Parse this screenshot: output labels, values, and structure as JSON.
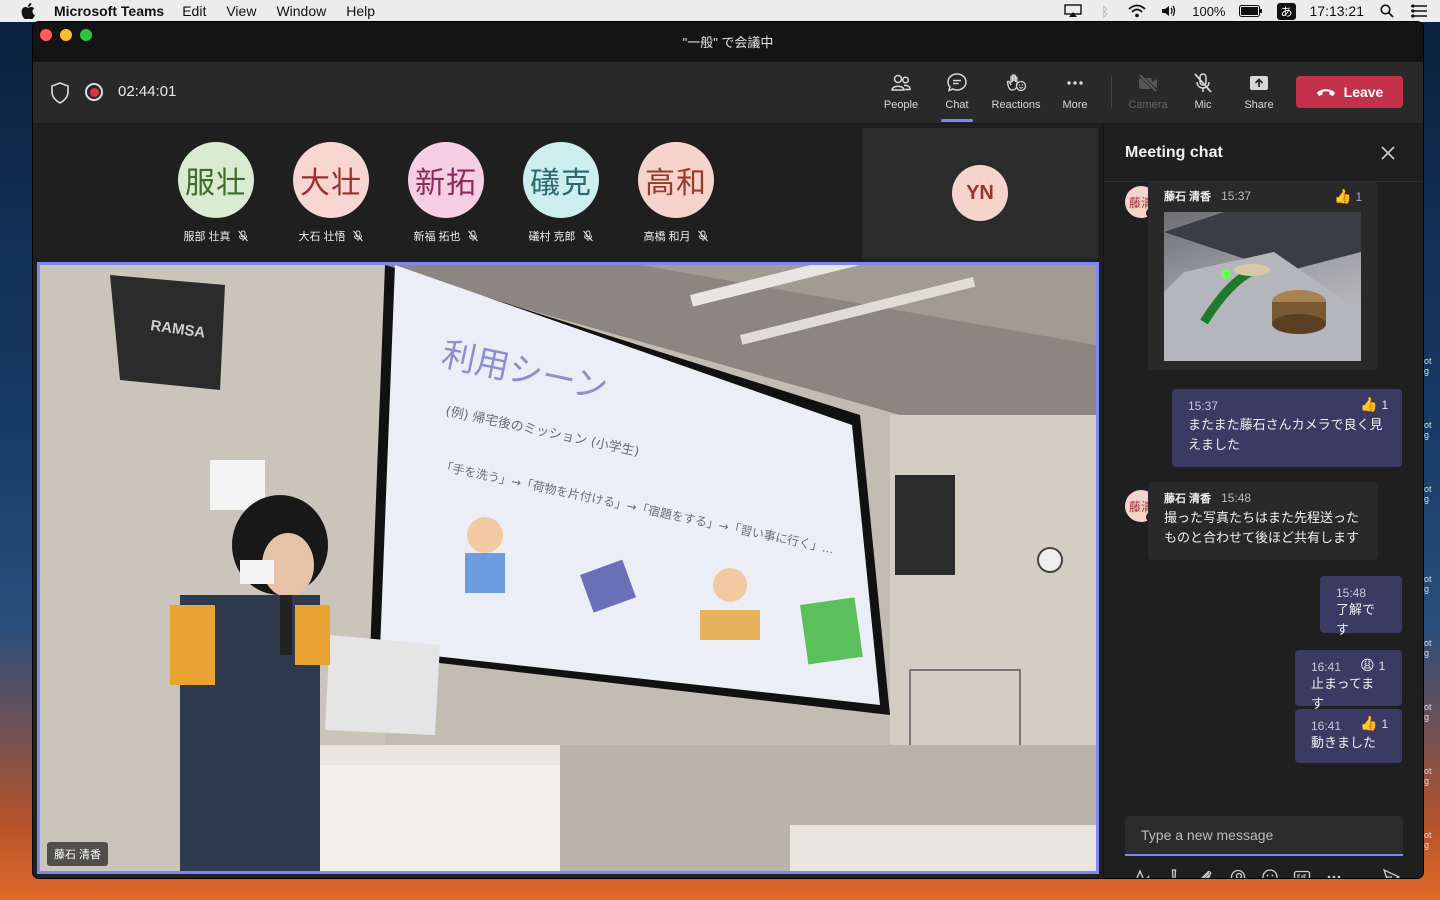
{
  "menubar": {
    "app_name": "Microsoft Teams",
    "menus": [
      "Edit",
      "View",
      "Window",
      "Help"
    ],
    "battery": "100%",
    "input_method": "あ",
    "clock": "17:13:21"
  },
  "window": {
    "title": "\"一般\" で会議中"
  },
  "toolbar": {
    "timer": "02:44:01",
    "buttons": [
      {
        "label": "People",
        "icon": "people-icon"
      },
      {
        "label": "Chat",
        "icon": "chat-icon",
        "active": true
      },
      {
        "label": "Reactions",
        "icon": "reactions-icon"
      },
      {
        "label": "More",
        "icon": "more-icon"
      },
      {
        "label": "Camera",
        "icon": "camera-off-icon",
        "disabled": true
      },
      {
        "label": "Mic",
        "icon": "mic-off-icon"
      },
      {
        "label": "Share",
        "icon": "share-icon"
      }
    ],
    "leave_label": "Leave",
    "accent_color": "#7f85f5",
    "leave_color": "#c4314b"
  },
  "participants": [
    {
      "initials": "服壮",
      "name": "服部 壮真",
      "bg": "#d9ecd2",
      "fg": "#3e6b2a"
    },
    {
      "initials": "大壮",
      "name": "大石 壮悟",
      "bg": "#f8d7d3",
      "fg": "#9b2f2a"
    },
    {
      "initials": "新拓",
      "name": "新福 拓也",
      "bg": "#f6cfe3",
      "fg": "#8c2a5c"
    },
    {
      "initials": "礒克",
      "name": "礒村 克郎",
      "bg": "#cdeeef",
      "fg": "#2b6870"
    },
    {
      "initials": "高和",
      "name": "高橋 和月",
      "bg": "#f6d4cc",
      "fg": "#9a3a2a"
    }
  ],
  "self_tile": {
    "initials": "YN"
  },
  "video": {
    "speaker_name": "藤石 清香",
    "slide_title": "利用シーン",
    "slide_line1": "(例) 帰宅後のミッション (小学生)",
    "slide_line2": "「手を洗う」→「荷物を片付ける」→「宿題をする」→「習い事に行く」...",
    "speaker_brand": "RAMSA"
  },
  "chat": {
    "title": "Meeting chat",
    "messages": [
      {
        "type": "in",
        "avatar": "藤清",
        "sender": "藤石 清香",
        "time": "15:37",
        "reaction": "👍",
        "count": "1",
        "image": true
      },
      {
        "type": "out",
        "time": "15:37",
        "text": "またまた藤石さんカメラで良く見えました",
        "reaction": "👍",
        "count": "1"
      },
      {
        "type": "in",
        "avatar": "藤清",
        "sender": "藤石 清香",
        "time": "15:48",
        "text": "撮った写真たちはまた先程送ったものと合わせて後ほど共有します"
      },
      {
        "type": "out",
        "time": "15:48",
        "text": "了解です"
      },
      {
        "type": "out",
        "time": "16:41",
        "text": "止まってます",
        "reaction": "😩",
        "count": "1"
      },
      {
        "type": "out",
        "time": "16:41",
        "text": "動きました",
        "reaction": "👍",
        "count": "1"
      }
    ],
    "compose_placeholder": "Type a new message"
  },
  "desktop_edge_text": [
    "ot",
    "g"
  ]
}
